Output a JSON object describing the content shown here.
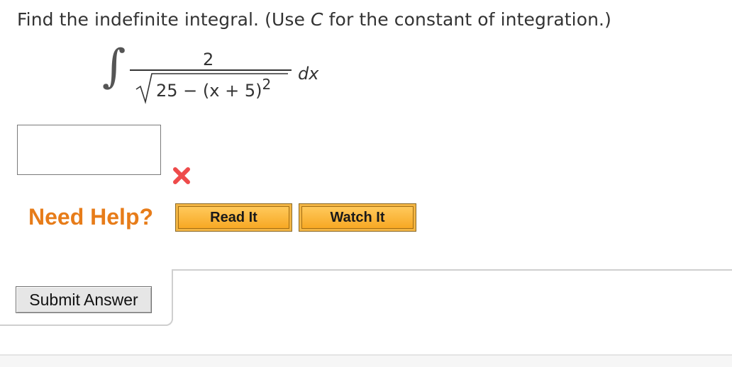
{
  "question": {
    "prefix": "Find the indefinite integral. (Use ",
    "variable": "C",
    "suffix": " for the constant of integration.)"
  },
  "integral": {
    "sign": "∫",
    "numerator": "2",
    "radicand_base": "25 − (x + 5)",
    "exponent": "2",
    "differential": "dx"
  },
  "answer": {
    "value": "",
    "status": "incorrect",
    "status_icon": "x-mark-icon",
    "status_color": "#ee4b4b"
  },
  "help": {
    "label": "Need Help?",
    "label_color": "#e77c19",
    "buttons": [
      {
        "label": "Read It"
      },
      {
        "label": "Watch It"
      }
    ],
    "button_color": "#f7b034"
  },
  "submit": {
    "label": "Submit Answer"
  }
}
